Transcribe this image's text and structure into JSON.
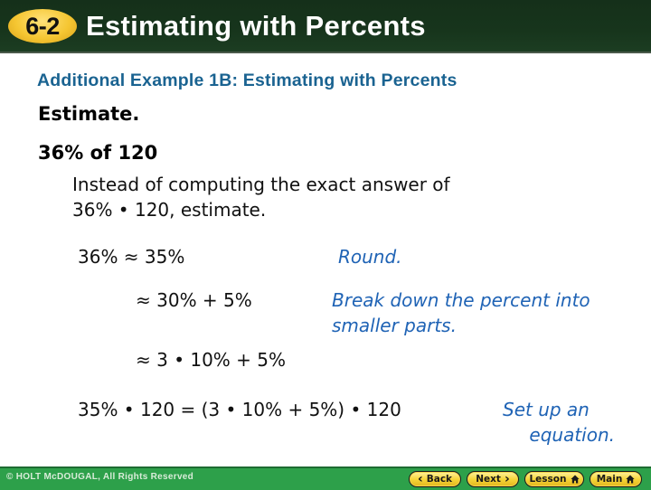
{
  "header": {
    "lesson_number": "6-2",
    "title": "Estimating with Percents"
  },
  "content": {
    "subtitle": "Additional Example 1B: Estimating with Percents",
    "instruction_heading": "Estimate.",
    "problem": "36% of 120",
    "explanation_line1": "Instead of computing the exact answer of",
    "explanation_line2": "36% • 120, estimate.",
    "steps": [
      {
        "left": "36% ≈ 35%",
        "note_lines": [
          "Round."
        ]
      },
      {
        "left": "≈ 30% + 5%",
        "note_lines": [
          "Break down the percent into",
          "smaller parts."
        ]
      },
      {
        "left": "≈ 3 • 10% + 5%",
        "note_lines": []
      }
    ],
    "equation": {
      "text": "35% • 120 = (3 • 10% + 5%) • 120",
      "note_lines": [
        "Set up an",
        "equation."
      ]
    }
  },
  "footer": {
    "copyright": "© HOLT McDOUGAL, All Rights Reserved",
    "nav": {
      "back": "Back",
      "next": "Next",
      "lesson": "Lesson",
      "main": "Main",
      "back_glyph": "‹",
      "next_glyph": "›"
    }
  },
  "colors": {
    "header_bg": "#17351c",
    "badge": "#f5c632",
    "subtitle": "#1a6391",
    "note": "#1f63b5",
    "footer_bg": "#2da04a",
    "button": "#f6d63a"
  }
}
